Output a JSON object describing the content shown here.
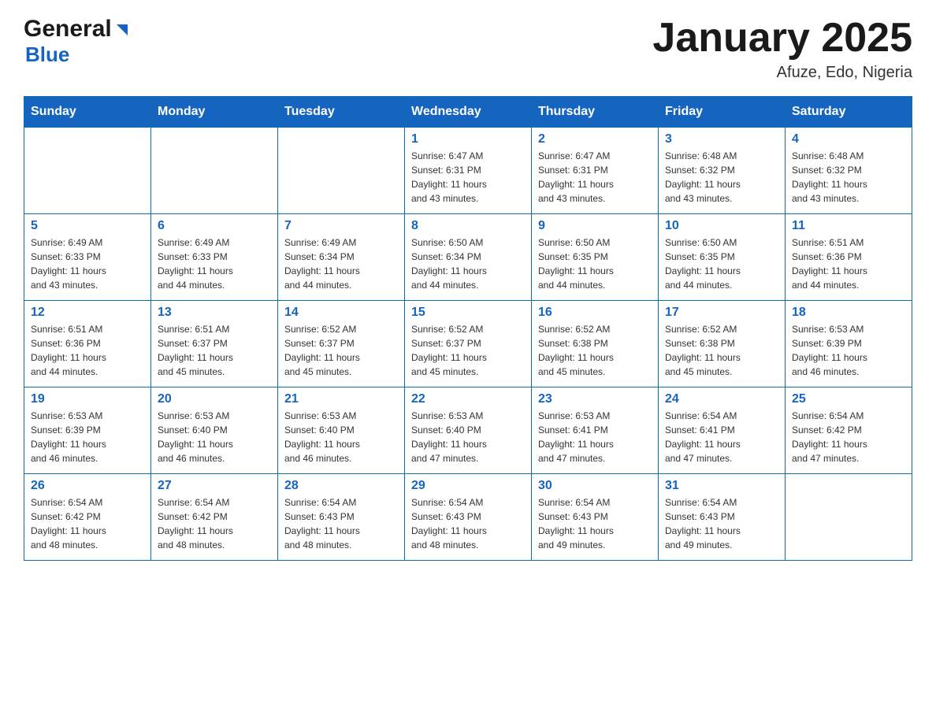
{
  "header": {
    "logo_general": "General",
    "logo_blue": "Blue",
    "title": "January 2025",
    "subtitle": "Afuze, Edo, Nigeria"
  },
  "weekdays": [
    "Sunday",
    "Monday",
    "Tuesday",
    "Wednesday",
    "Thursday",
    "Friday",
    "Saturday"
  ],
  "weeks": [
    [
      {
        "day": "",
        "info": ""
      },
      {
        "day": "",
        "info": ""
      },
      {
        "day": "",
        "info": ""
      },
      {
        "day": "1",
        "info": "Sunrise: 6:47 AM\nSunset: 6:31 PM\nDaylight: 11 hours\nand 43 minutes."
      },
      {
        "day": "2",
        "info": "Sunrise: 6:47 AM\nSunset: 6:31 PM\nDaylight: 11 hours\nand 43 minutes."
      },
      {
        "day": "3",
        "info": "Sunrise: 6:48 AM\nSunset: 6:32 PM\nDaylight: 11 hours\nand 43 minutes."
      },
      {
        "day": "4",
        "info": "Sunrise: 6:48 AM\nSunset: 6:32 PM\nDaylight: 11 hours\nand 43 minutes."
      }
    ],
    [
      {
        "day": "5",
        "info": "Sunrise: 6:49 AM\nSunset: 6:33 PM\nDaylight: 11 hours\nand 43 minutes."
      },
      {
        "day": "6",
        "info": "Sunrise: 6:49 AM\nSunset: 6:33 PM\nDaylight: 11 hours\nand 44 minutes."
      },
      {
        "day": "7",
        "info": "Sunrise: 6:49 AM\nSunset: 6:34 PM\nDaylight: 11 hours\nand 44 minutes."
      },
      {
        "day": "8",
        "info": "Sunrise: 6:50 AM\nSunset: 6:34 PM\nDaylight: 11 hours\nand 44 minutes."
      },
      {
        "day": "9",
        "info": "Sunrise: 6:50 AM\nSunset: 6:35 PM\nDaylight: 11 hours\nand 44 minutes."
      },
      {
        "day": "10",
        "info": "Sunrise: 6:50 AM\nSunset: 6:35 PM\nDaylight: 11 hours\nand 44 minutes."
      },
      {
        "day": "11",
        "info": "Sunrise: 6:51 AM\nSunset: 6:36 PM\nDaylight: 11 hours\nand 44 minutes."
      }
    ],
    [
      {
        "day": "12",
        "info": "Sunrise: 6:51 AM\nSunset: 6:36 PM\nDaylight: 11 hours\nand 44 minutes."
      },
      {
        "day": "13",
        "info": "Sunrise: 6:51 AM\nSunset: 6:37 PM\nDaylight: 11 hours\nand 45 minutes."
      },
      {
        "day": "14",
        "info": "Sunrise: 6:52 AM\nSunset: 6:37 PM\nDaylight: 11 hours\nand 45 minutes."
      },
      {
        "day": "15",
        "info": "Sunrise: 6:52 AM\nSunset: 6:37 PM\nDaylight: 11 hours\nand 45 minutes."
      },
      {
        "day": "16",
        "info": "Sunrise: 6:52 AM\nSunset: 6:38 PM\nDaylight: 11 hours\nand 45 minutes."
      },
      {
        "day": "17",
        "info": "Sunrise: 6:52 AM\nSunset: 6:38 PM\nDaylight: 11 hours\nand 45 minutes."
      },
      {
        "day": "18",
        "info": "Sunrise: 6:53 AM\nSunset: 6:39 PM\nDaylight: 11 hours\nand 46 minutes."
      }
    ],
    [
      {
        "day": "19",
        "info": "Sunrise: 6:53 AM\nSunset: 6:39 PM\nDaylight: 11 hours\nand 46 minutes."
      },
      {
        "day": "20",
        "info": "Sunrise: 6:53 AM\nSunset: 6:40 PM\nDaylight: 11 hours\nand 46 minutes."
      },
      {
        "day": "21",
        "info": "Sunrise: 6:53 AM\nSunset: 6:40 PM\nDaylight: 11 hours\nand 46 minutes."
      },
      {
        "day": "22",
        "info": "Sunrise: 6:53 AM\nSunset: 6:40 PM\nDaylight: 11 hours\nand 47 minutes."
      },
      {
        "day": "23",
        "info": "Sunrise: 6:53 AM\nSunset: 6:41 PM\nDaylight: 11 hours\nand 47 minutes."
      },
      {
        "day": "24",
        "info": "Sunrise: 6:54 AM\nSunset: 6:41 PM\nDaylight: 11 hours\nand 47 minutes."
      },
      {
        "day": "25",
        "info": "Sunrise: 6:54 AM\nSunset: 6:42 PM\nDaylight: 11 hours\nand 47 minutes."
      }
    ],
    [
      {
        "day": "26",
        "info": "Sunrise: 6:54 AM\nSunset: 6:42 PM\nDaylight: 11 hours\nand 48 minutes."
      },
      {
        "day": "27",
        "info": "Sunrise: 6:54 AM\nSunset: 6:42 PM\nDaylight: 11 hours\nand 48 minutes."
      },
      {
        "day": "28",
        "info": "Sunrise: 6:54 AM\nSunset: 6:43 PM\nDaylight: 11 hours\nand 48 minutes."
      },
      {
        "day": "29",
        "info": "Sunrise: 6:54 AM\nSunset: 6:43 PM\nDaylight: 11 hours\nand 48 minutes."
      },
      {
        "day": "30",
        "info": "Sunrise: 6:54 AM\nSunset: 6:43 PM\nDaylight: 11 hours\nand 49 minutes."
      },
      {
        "day": "31",
        "info": "Sunrise: 6:54 AM\nSunset: 6:43 PM\nDaylight: 11 hours\nand 49 minutes."
      },
      {
        "day": "",
        "info": ""
      }
    ]
  ]
}
